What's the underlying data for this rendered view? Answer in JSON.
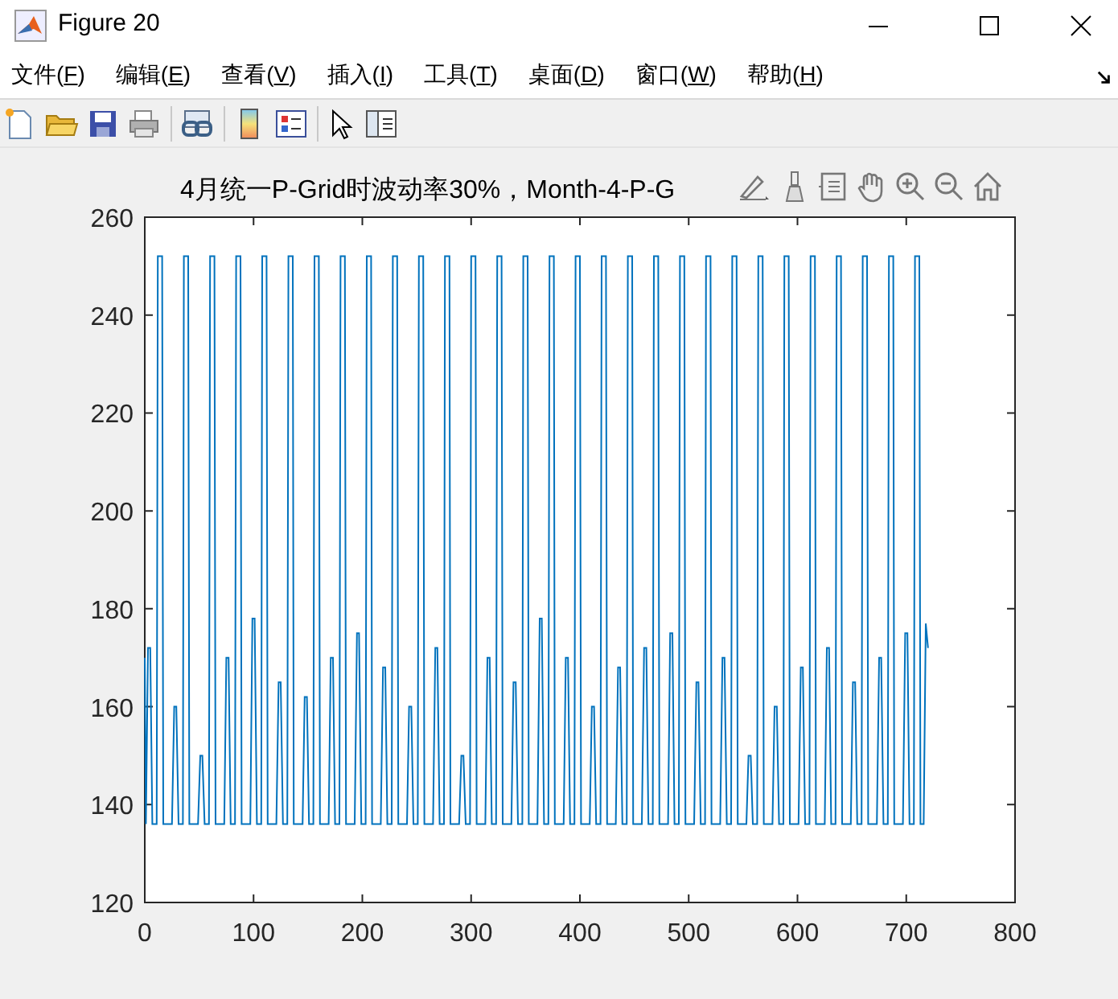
{
  "window": {
    "title": "Figure 20"
  },
  "menu": [
    {
      "prefix": "文件(",
      "key": "F",
      "suffix": ")"
    },
    {
      "prefix": "编辑(",
      "key": "E",
      "suffix": ")"
    },
    {
      "prefix": "查看(",
      "key": "V",
      "suffix": ")"
    },
    {
      "prefix": "插入(",
      "key": "I",
      "suffix": ")"
    },
    {
      "prefix": "工具(",
      "key": "T",
      "suffix": ")"
    },
    {
      "prefix": "桌面(",
      "key": "D",
      "suffix": ")"
    },
    {
      "prefix": "窗口(",
      "key": "W",
      "suffix": ")"
    },
    {
      "prefix": "帮助(",
      "key": "H",
      "suffix": ")"
    }
  ],
  "axes": {
    "chart_data": {
      "type": "line",
      "title": "4月统一P-Grid时波动率30%，Month-4-P-G",
      "xlim": [
        0,
        800
      ],
      "ylim": [
        120,
        260
      ],
      "xticks": [
        0,
        100,
        200,
        300,
        400,
        500,
        600,
        700,
        800
      ],
      "yticks": [
        120,
        140,
        160,
        180,
        200,
        220,
        240,
        260
      ],
      "x": [
        0,
        1,
        3,
        5,
        7,
        11,
        12,
        16,
        17,
        25,
        27,
        29,
        31,
        35,
        36,
        40,
        41,
        49,
        51,
        53,
        55,
        59,
        60,
        64,
        65,
        73,
        75,
        77,
        79,
        83,
        84,
        88,
        89,
        97,
        99,
        101,
        103,
        107,
        108,
        112,
        113,
        121,
        123,
        125,
        127,
        131,
        132,
        136,
        137,
        145,
        147,
        149,
        151,
        155,
        156,
        160,
        161,
        169,
        171,
        173,
        175,
        179,
        180,
        184,
        185,
        193,
        195,
        197,
        199,
        203,
        204,
        208,
        209,
        217,
        219,
        221,
        223,
        227,
        228,
        232,
        233,
        241,
        243,
        245,
        247,
        251,
        252,
        256,
        257,
        265,
        267,
        269,
        271,
        275,
        276,
        280,
        281,
        289,
        291,
        293,
        295,
        299,
        300,
        304,
        305,
        313,
        315,
        317,
        319,
        323,
        324,
        328,
        329,
        337,
        339,
        341,
        343,
        347,
        348,
        352,
        353,
        361,
        363,
        365,
        367,
        371,
        372,
        376,
        377,
        385,
        387,
        389,
        391,
        395,
        396,
        400,
        401,
        409,
        411,
        413,
        415,
        419,
        420,
        424,
        425,
        433,
        435,
        437,
        439,
        443,
        444,
        448,
        449,
        457,
        459,
        461,
        463,
        467,
        468,
        472,
        473,
        481,
        483,
        485,
        487,
        491,
        492,
        496,
        497,
        505,
        507,
        509,
        511,
        515,
        516,
        520,
        521,
        529,
        531,
        533,
        535,
        539,
        540,
        544,
        545,
        553,
        555,
        557,
        559,
        563,
        564,
        568,
        569,
        577,
        579,
        581,
        583,
        587,
        588,
        592,
        593,
        601,
        603,
        605,
        607,
        611,
        612,
        616,
        617,
        625,
        627,
        629,
        631,
        635,
        636,
        640,
        641,
        649,
        651,
        653,
        655,
        659,
        660,
        664,
        665,
        673,
        675,
        677,
        679,
        683,
        684,
        688,
        689,
        697,
        699,
        701,
        703,
        707,
        708,
        712,
        713,
        716,
        718,
        720
      ],
      "series": [
        {
          "color": "#0072bd",
          "values": [
            170,
            136,
            172,
            172,
            136,
            136,
            252,
            252,
            136,
            136,
            160,
            160,
            136,
            136,
            252,
            252,
            136,
            136,
            150,
            150,
            136,
            136,
            252,
            252,
            136,
            136,
            170,
            170,
            136,
            136,
            252,
            252,
            136,
            136,
            178,
            178,
            136,
            136,
            252,
            252,
            136,
            136,
            165,
            165,
            136,
            136,
            252,
            252,
            136,
            136,
            162,
            162,
            136,
            136,
            252,
            252,
            136,
            136,
            170,
            170,
            136,
            136,
            252,
            252,
            136,
            136,
            175,
            175,
            136,
            136,
            252,
            252,
            136,
            136,
            168,
            168,
            136,
            136,
            252,
            252,
            136,
            136,
            160,
            160,
            136,
            136,
            252,
            252,
            136,
            136,
            172,
            172,
            136,
            136,
            252,
            252,
            136,
            136,
            150,
            150,
            136,
            136,
            252,
            252,
            136,
            136,
            170,
            170,
            136,
            136,
            252,
            252,
            136,
            136,
            165,
            165,
            136,
            136,
            252,
            252,
            136,
            136,
            178,
            178,
            136,
            136,
            252,
            252,
            136,
            136,
            170,
            170,
            136,
            136,
            252,
            252,
            136,
            136,
            160,
            160,
            136,
            136,
            252,
            252,
            136,
            136,
            168,
            168,
            136,
            136,
            252,
            252,
            136,
            136,
            172,
            172,
            136,
            136,
            252,
            252,
            136,
            136,
            175,
            175,
            136,
            136,
            252,
            252,
            136,
            136,
            165,
            165,
            136,
            136,
            252,
            252,
            136,
            136,
            170,
            170,
            136,
            136,
            252,
            252,
            136,
            136,
            150,
            150,
            136,
            136,
            252,
            252,
            136,
            136,
            160,
            160,
            136,
            136,
            252,
            252,
            136,
            136,
            168,
            168,
            136,
            136,
            252,
            252,
            136,
            136,
            172,
            172,
            136,
            136,
            252,
            252,
            136,
            136,
            165,
            165,
            136,
            136,
            252,
            252,
            136,
            136,
            170,
            170,
            136,
            136,
            252,
            252,
            136,
            136,
            175,
            175,
            136,
            136,
            252,
            252,
            136,
            136,
            177,
            172
          ]
        }
      ]
    }
  }
}
